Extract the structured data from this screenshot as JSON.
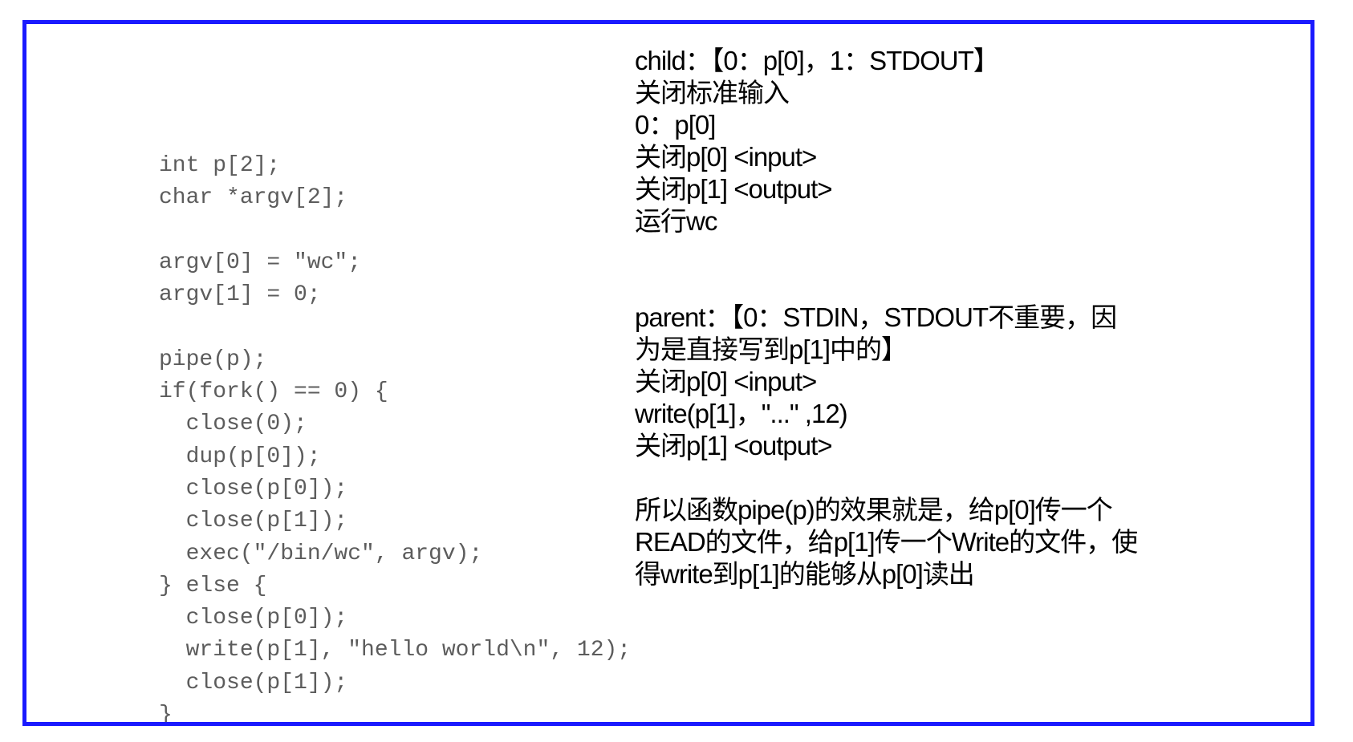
{
  "code_lines": [
    "int p[2];",
    "char *argv[2];",
    "",
    "argv[0] = \"wc\";",
    "argv[1] = 0;",
    "",
    "pipe(p);",
    "if(fork() == 0) {",
    "  close(0);",
    "  dup(p[0]);",
    "  close(p[0]);",
    "  close(p[1]);",
    "  exec(\"/bin/wc\", argv);",
    "} else {",
    "  close(p[0]);",
    "  write(p[1], \"hello world\\n\", 12);",
    "  close(p[1]);",
    "}"
  ],
  "child_notes": [
    "child：【0：p[0]，1：STDOUT】",
    "关闭标准输入",
    "0：p[0]",
    "关闭p[0] <input>",
    "关闭p[1] <output>",
    "运行wc"
  ],
  "parent_notes": [
    "parent：【0：STDIN，STDOUT不重要，因",
    "为是直接写到p[1]中的】",
    "关闭p[0] <input>",
    "write(p[1]，\"...\" ,12)",
    "关闭p[1] <output>"
  ],
  "summary_notes": [
    "所以函数pipe(p)的效果就是，给p[0]传一个",
    "READ的文件，给p[1]传一个Write的文件，使",
    "得write到p[1]的能够从p[0]读出"
  ],
  "colors": {
    "border": "#1a1aff",
    "code_text": "#5c5c5c",
    "note_text": "#000000"
  }
}
